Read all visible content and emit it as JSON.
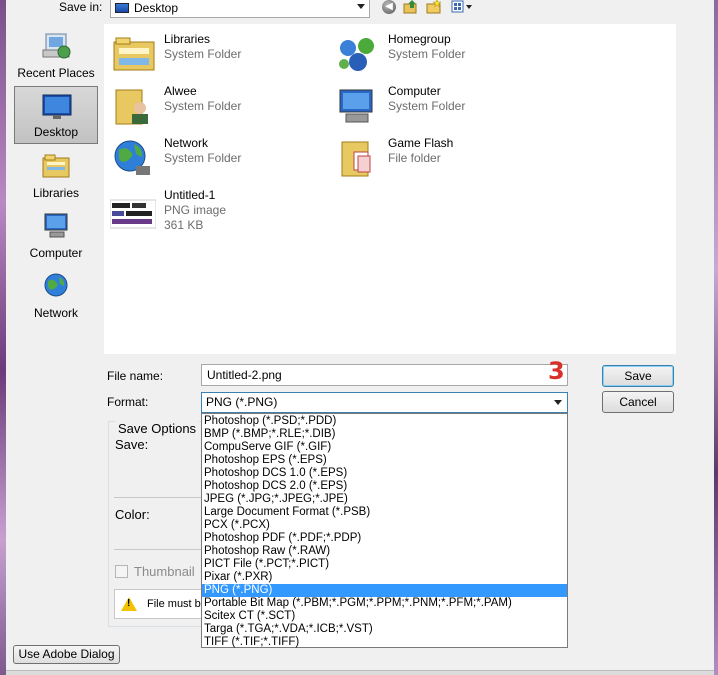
{
  "save_in": {
    "label": "Save in:",
    "value": "Desktop"
  },
  "toolbar": {
    "back_icon": "back-icon",
    "up_icon": "up-folder-icon",
    "new_folder_icon": "new-folder-icon",
    "views_icon": "views-menu-icon"
  },
  "places": [
    {
      "label": "Recent Places",
      "icon": "recent-places-icon"
    },
    {
      "label": "Desktop",
      "icon": "desktop-icon",
      "selected": true
    },
    {
      "label": "Libraries",
      "icon": "libraries-icon"
    },
    {
      "label": "Computer",
      "icon": "computer-icon"
    },
    {
      "label": "Network",
      "icon": "network-icon"
    }
  ],
  "files": [
    {
      "name": "Libraries",
      "sub1": "System Folder",
      "icon": "libraries-icon"
    },
    {
      "name": "Homegroup",
      "sub1": "System Folder",
      "icon": "homegroup-icon"
    },
    {
      "name": "Alwee",
      "sub1": "System Folder",
      "icon": "user-folder-icon"
    },
    {
      "name": "Computer",
      "sub1": "System Folder",
      "icon": "computer-icon"
    },
    {
      "name": "Network",
      "sub1": "System Folder",
      "icon": "network-icon"
    },
    {
      "name": "Game Flash",
      "sub1": "File folder",
      "icon": "folder-icon"
    },
    {
      "name": "Untitled-1",
      "sub1": "PNG image",
      "sub2": "361 KB",
      "icon": "png-thumbnail-icon"
    }
  ],
  "form": {
    "file_name_label": "File name:",
    "file_name_value": "Untitled-2.png",
    "format_label": "Format:",
    "format_value": "PNG (*.PNG)",
    "save_button": "Save",
    "cancel_button": "Cancel",
    "step_annotation": "3"
  },
  "format_options": [
    "Photoshop (*.PSD;*.PDD)",
    "BMP (*.BMP;*.RLE;*.DIB)",
    "CompuServe GIF (*.GIF)",
    "Photoshop EPS (*.EPS)",
    "Photoshop DCS 1.0 (*.EPS)",
    "Photoshop DCS 2.0 (*.EPS)",
    "JPEG (*.JPG;*.JPEG;*.JPE)",
    "Large Document Format (*.PSB)",
    "PCX (*.PCX)",
    "Photoshop PDF (*.PDF;*.PDP)",
    "Photoshop Raw (*.RAW)",
    "PICT File (*.PCT;*.PICT)",
    "Pixar (*.PXR)",
    "PNG (*.PNG)",
    "Portable Bit Map (*.PBM;*.PGM;*.PPM;*.PNM;*.PFM;*.PAM)",
    "Scitex CT (*.SCT)",
    "Targa (*.TGA;*.VDA;*.ICB;*.VST)",
    "TIFF (*.TIF;*.TIFF)"
  ],
  "format_selected_index": 13,
  "save_options": {
    "title": "Save Options",
    "save_label": "Save:",
    "color_label": "Color:",
    "thumbnail_label": "Thumbnail",
    "warning_text": "File must be"
  },
  "adobe_dialog_button": "Use Adobe Dialog",
  "colors": {
    "accent": "#3399ff",
    "annotation": "#d9302a",
    "default_button_border": "#3c7fb1"
  }
}
